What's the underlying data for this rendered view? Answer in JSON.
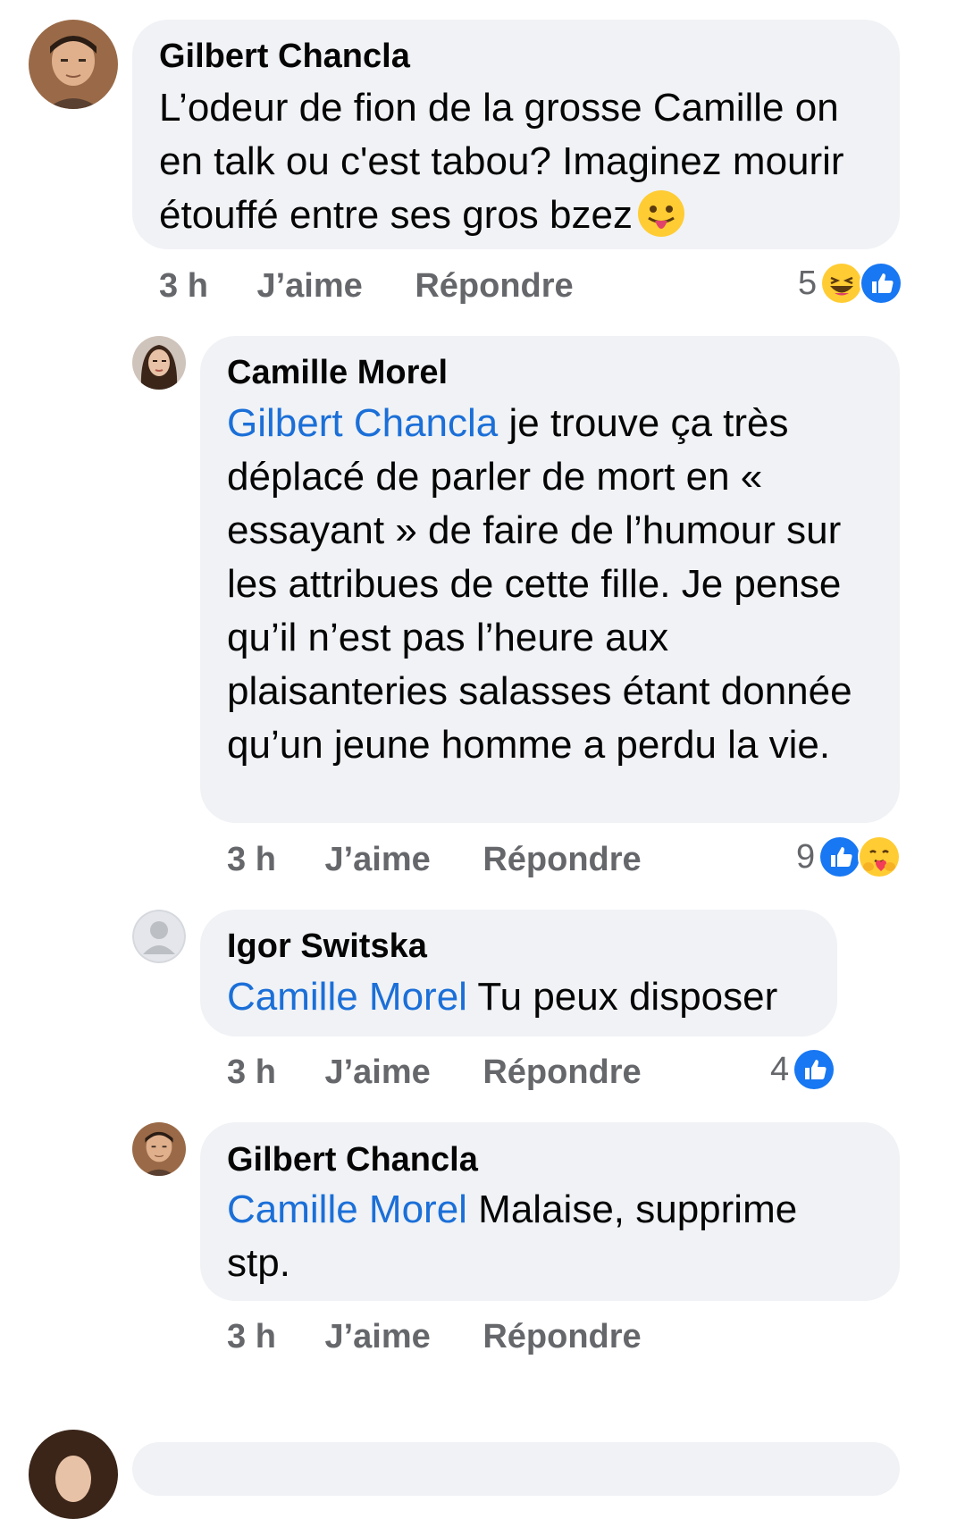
{
  "comments": [
    {
      "author": "Gilbert Chancla",
      "mention": "",
      "text": "L’odeur de fion de la grosse Camille on en talk ou c'est tabou?  Imaginez mourir étouffé entre ses gros bzez",
      "emoji": "face-with-tongue",
      "time": "3 h",
      "like": "J’aime",
      "reply": "Répondre",
      "reaction_count": "5",
      "reactions": [
        "haha",
        "like"
      ]
    },
    {
      "author": "Camille Morel",
      "mention": "Gilbert Chancla",
      "text": " je trouve ça très déplacé de parler de mort en « essayant » de faire de l’humour sur les attribues de cette fille. Je pense qu’il n’est pas l’heure aux plaisanteries salasses étant donnée qu’un jeune homme a perdu la vie.",
      "time": "3 h",
      "like": "J’aime",
      "reply": "Répondre",
      "reaction_count": "9",
      "reactions": [
        "like",
        "care"
      ]
    },
    {
      "author": "Igor Switska",
      "mention": "Camille Morel",
      "text": " Tu peux disposer",
      "time": "3 h",
      "like": "J’aime",
      "reply": "Répondre",
      "reaction_count": "4",
      "reactions": [
        "like"
      ]
    },
    {
      "author": "Gilbert Chancla",
      "mention": "Camille Morel",
      "text": " Malaise, supprime stp.",
      "time": "3 h",
      "like": "J’aime",
      "reply": "Répondre",
      "reaction_count": "",
      "reactions": []
    }
  ],
  "colors": {
    "bubble": "#f0f2f5",
    "mention": "#1b6fd8",
    "meta": "#65676b",
    "like_blue": "#1877f2"
  }
}
